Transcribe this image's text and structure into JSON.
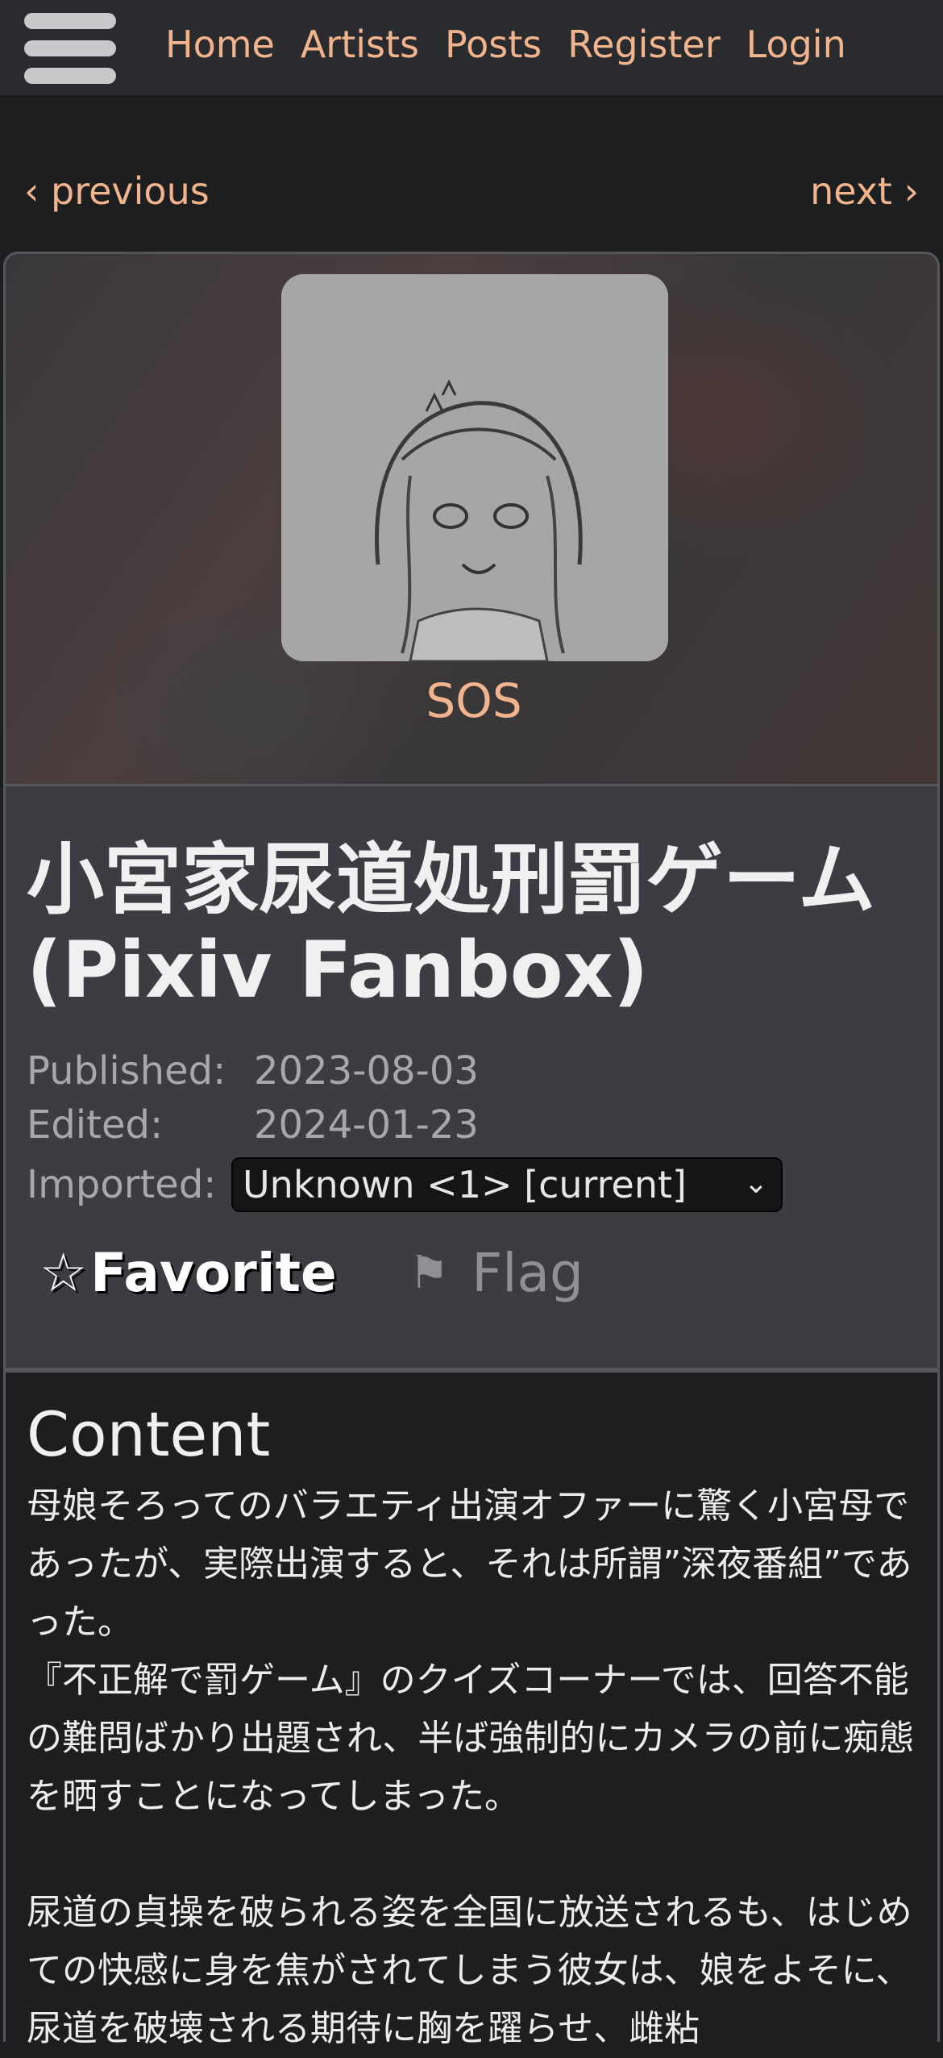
{
  "nav": {
    "items": [
      "Home",
      "Artists",
      "Posts",
      "Register",
      "Login"
    ]
  },
  "pager": {
    "previous": "‹ previous",
    "next": "next ›"
  },
  "artist": {
    "name": "SOS"
  },
  "post": {
    "title": "小宮家尿道処刑罰ゲーム (Pixiv Fanbox)",
    "published_label": "Published:",
    "published": "2023-08-03",
    "edited_label": "Edited:",
    "edited": "2024-01-23",
    "imported_label": "Imported:",
    "imported_value": "Unknown <1> [current]",
    "favorite_label": "Favorite",
    "flag_label": "Flag"
  },
  "content": {
    "heading": "Content",
    "paragraphs": [
      "母娘そろってのバラエティ出演オファーに驚く小宮母であったが、実際出演すると、それは所謂”深夜番組”であった。",
      "『不正解で罰ゲーム』のクイズコーナーでは、回答不能の難問ばかり出題され、半ば強制的にカメラの前に痴態を晒すことになってしまった。",
      "尿道の貞操を破られる姿を全国に放送されるも、はじめての快感に身を焦がされてしまう彼女は、娘をよそに、尿道を破壊される期待に胸を躍らせ、雌粘"
    ]
  },
  "colors": {
    "accent": "#f2b48c",
    "background": "#1d1e20",
    "topbar": "#2a2b2e",
    "info_panel": "#3b3d42"
  },
  "icons": {
    "menu": "hamburger-icon",
    "favorite": "star-outline-icon",
    "flag": "flag-icon",
    "select": "chevron-down-icon"
  }
}
